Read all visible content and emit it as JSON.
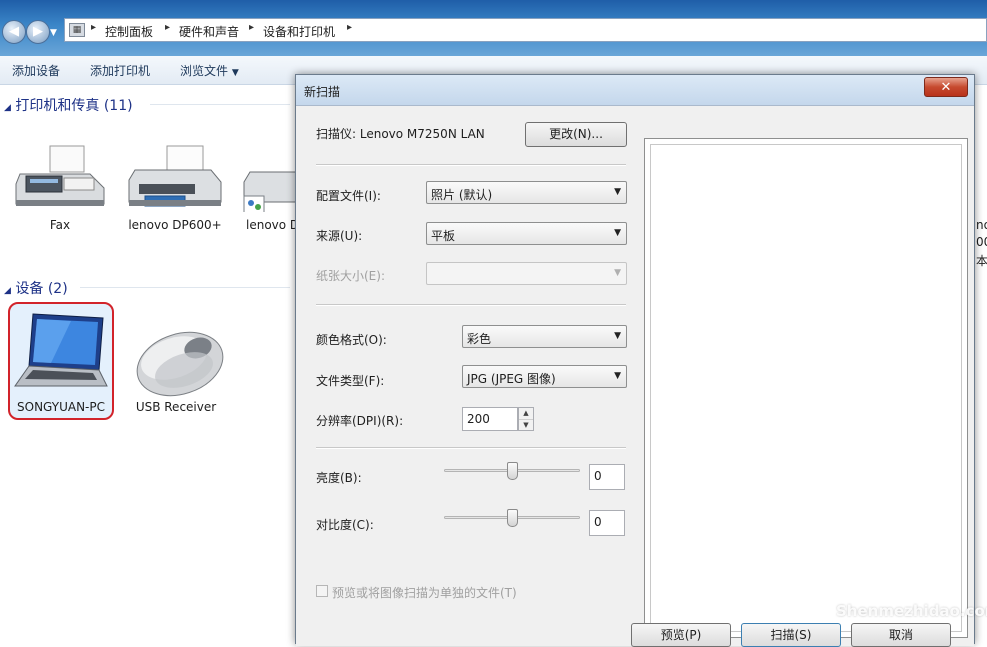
{
  "explorer": {
    "breadcrumbs": [
      "控制面板",
      "硬件和声音",
      "设备和打印机"
    ],
    "toolbar": {
      "add_device": "添加设备",
      "add_printer": "添加打印机",
      "browse_files": "浏览文件"
    },
    "printers_section": "打印机和传真 (11)",
    "devices_section": "设备 (2)",
    "printers": [
      {
        "label": "Fax",
        "icon": "fax-icon"
      },
      {
        "label": "lenovo DP600+",
        "icon": "printer-icon"
      },
      {
        "label": "lenovo D",
        "icon": "printer-icon"
      }
    ],
    "devices": [
      {
        "label": "SONGYUAN-PC",
        "icon": "laptop-icon"
      },
      {
        "label": "USB Receiver",
        "icon": "mouse-icon"
      }
    ],
    "partial_right": [
      "no",
      "00",
      "本"
    ]
  },
  "dialog": {
    "title": "新扫描",
    "close": "✕",
    "scanner_label": "扫描仪: Lenovo M7250N LAN",
    "change_button": "更改(N)...",
    "profile_label": "配置文件(I):",
    "profile_value": "照片 (默认)",
    "source_label": "来源(U):",
    "source_value": "平板",
    "paper_label": "纸张大小(E):",
    "paper_value": "",
    "color_label": "颜色格式(O):",
    "color_value": "彩色",
    "filetype_label": "文件类型(F):",
    "filetype_value": "JPG (JPEG 图像)",
    "resolution_label": "分辨率(DPI)(R):",
    "resolution_value": "200",
    "brightness_label": "亮度(B):",
    "brightness_value": "0",
    "brightness_level": 0.5,
    "contrast_label": "对比度(C):",
    "contrast_value": "0",
    "contrast_level": 0.5,
    "separate_files_label": "预览或将图像扫描为单独的文件(T)",
    "bottom_buttons": [
      "预览(P)",
      "扫描(S)",
      "取消"
    ]
  },
  "watermark": "Shenmezhidao.com"
}
